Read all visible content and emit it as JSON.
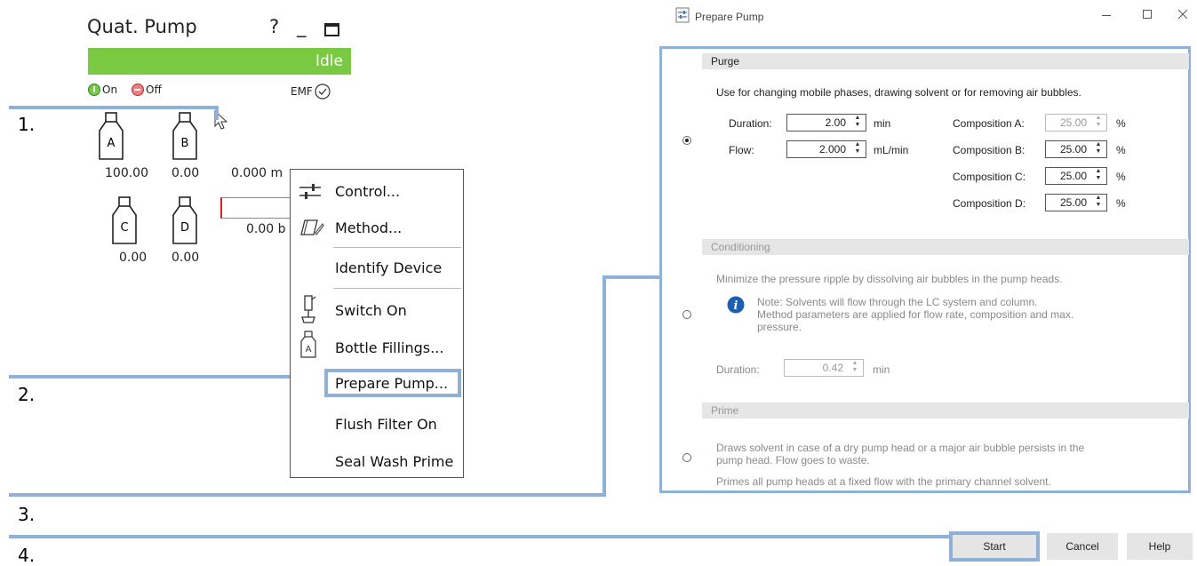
{
  "left_panel": {
    "title": "Quat. Pump",
    "help_glyph": "?",
    "minimize_glyph": "_",
    "status": "Idle",
    "status_color": "#7ac943",
    "on_label": "On",
    "off_label": "Off",
    "emf_label": "EMF",
    "bottles": [
      {
        "letter": "A",
        "value": "100.00"
      },
      {
        "letter": "B",
        "value": "0.00"
      },
      {
        "letter": "C",
        "value": "0.00"
      },
      {
        "letter": "D",
        "value": "0.00"
      }
    ],
    "flow_text": "0.000 m",
    "pressure_text": "0.00 b"
  },
  "steps": [
    "1.",
    "2.",
    "3.",
    "4."
  ],
  "highlight_color": "#8fb1d8",
  "context_menu": {
    "items": [
      {
        "label": "Control...",
        "icon": "sliders-icon"
      },
      {
        "label": "Method...",
        "icon": "method-icon"
      },
      {
        "label": "Identify Device",
        "icon": ""
      },
      {
        "label": "Switch On",
        "icon": "pump-switch-icon"
      },
      {
        "label": "Bottle Fillings...",
        "icon": "bottle-icon"
      },
      {
        "label": "Prepare Pump...",
        "icon": ""
      },
      {
        "label": "Flush Filter On",
        "icon": ""
      },
      {
        "label": "Seal Wash Prime",
        "icon": ""
      }
    ],
    "bottle_icon_letter": "A"
  },
  "dialog": {
    "title": "Prepare Pump",
    "purge": {
      "header": "Purge",
      "description": "Use for changing mobile phases, drawing solvent or for removing air bubbles.",
      "duration_label": "Duration:",
      "duration_value": "2.00",
      "duration_unit": "min",
      "flow_label": "Flow:",
      "flow_value": "2.000",
      "flow_unit": "mL/min",
      "compositions": [
        {
          "label": "Composition A:",
          "value": "25.00",
          "unit": "%"
        },
        {
          "label": "Composition B:",
          "value": "25.00",
          "unit": "%"
        },
        {
          "label": "Composition C:",
          "value": "25.00",
          "unit": "%"
        },
        {
          "label": "Composition D:",
          "value": "25.00",
          "unit": "%"
        }
      ]
    },
    "conditioning": {
      "header": "Conditioning",
      "description": "Minimize the pressure ripple by dissolving air bubbles in the pump heads.",
      "note_line1": "Note: Solvents will flow through the LC system and column.",
      "note_line2": "Method parameters are applied for flow rate, composition and max.",
      "note_line3": "pressure.",
      "duration_label": "Duration:",
      "duration_value": "0.42",
      "duration_unit": "min"
    },
    "prime": {
      "header": "Prime",
      "line1": "Draws solvent in case of a dry pump head or a major air bubble persists in the",
      "line2": "pump head. Flow goes to waste.",
      "line3": "Primes all pump heads at a fixed flow with the primary channel solvent."
    },
    "buttons": {
      "start": "Start",
      "cancel": "Cancel",
      "help": "Help"
    },
    "selected_mode": "purge"
  }
}
